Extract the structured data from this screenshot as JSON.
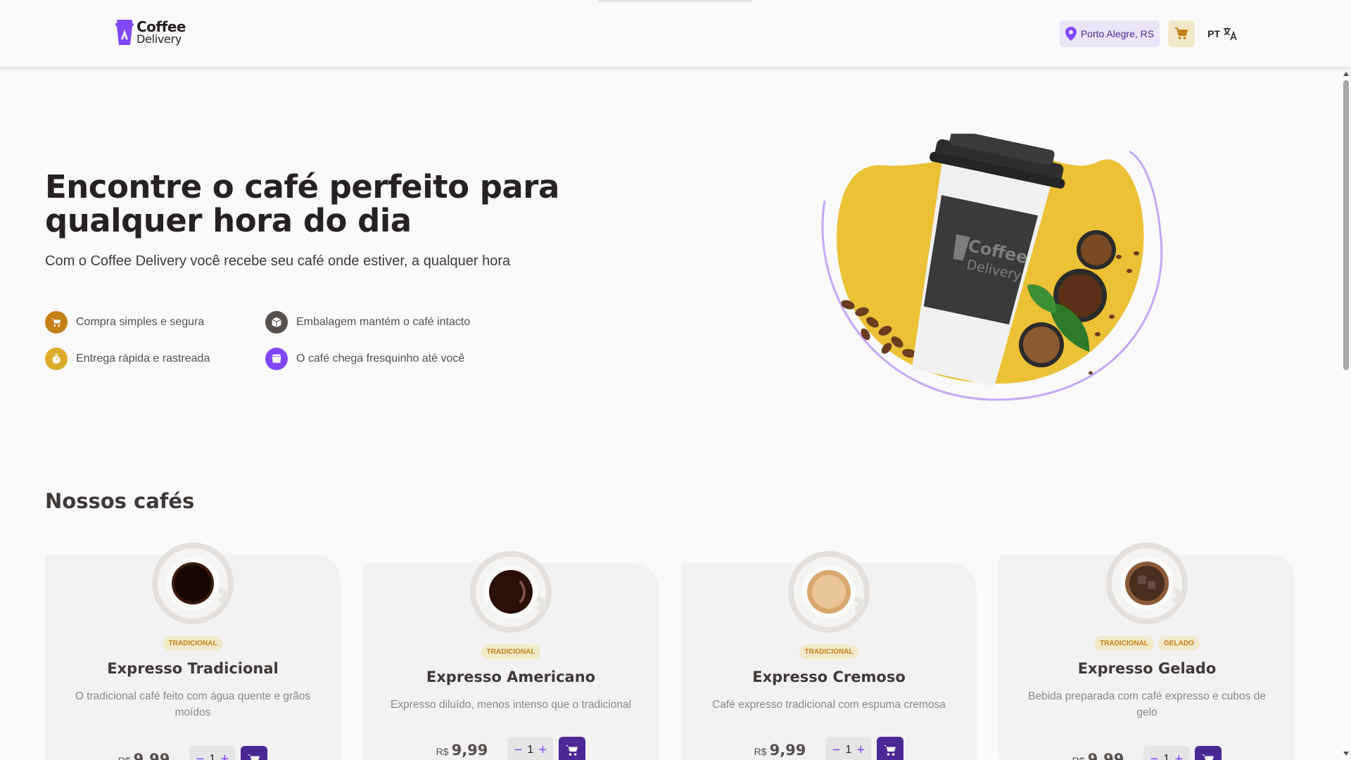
{
  "header": {
    "logo_line1": "Coffee",
    "logo_line2": "Delivery",
    "location": "Porto Alegre, RS",
    "language": "PT"
  },
  "hero": {
    "title": "Encontre o café perfeito para qualquer hora do dia",
    "subtitle": "Com o Coffee Delivery você recebe seu café onde estiver, a qualquer hora",
    "features": [
      {
        "label": "Compra simples e segura",
        "icon": "cart-icon",
        "color": "#c47f17"
      },
      {
        "label": "Embalagem mantém o café intacto",
        "icon": "package-icon",
        "color": "#574f4d"
      },
      {
        "label": "Entrega rápida e rastreada",
        "icon": "timer-icon",
        "color": "#dbac2c"
      },
      {
        "label": "O café chega fresquinho até você",
        "icon": "coffee-icon",
        "color": "#8047f8"
      }
    ],
    "cup_brand_line1": "Coffee",
    "cup_brand_line2": "Delivery"
  },
  "catalog": {
    "title": "Nossos cafés",
    "currency": "R$",
    "coffees": [
      {
        "name": "Expresso Tradicional",
        "tags": [
          "TRADICIONAL"
        ],
        "description": "O tradicional café feito com água quente e grãos moídos",
        "price": "9,99",
        "quantity": "1"
      },
      {
        "name": "Expresso Americano",
        "tags": [
          "TRADICIONAL"
        ],
        "description": "Expresso diluído, menos intenso que o tradicional",
        "price": "9,99",
        "quantity": "1"
      },
      {
        "name": "Expresso Cremoso",
        "tags": [
          "TRADICIONAL"
        ],
        "description": "Café expresso tradicional com espuma cremosa",
        "price": "9,99",
        "quantity": "1"
      },
      {
        "name": "Expresso Gelado",
        "tags": [
          "TRADICIONAL",
          "GELADO"
        ],
        "description": "Bebida preparada com café expresso e cubos de gelo",
        "price": "9,99",
        "quantity": "1"
      }
    ]
  },
  "colors": {
    "purple_dark": "#4b2995",
    "purple": "#8047f8",
    "purple_light": "#ebe5f9",
    "yellow_dark": "#c47f17",
    "yellow": "#dbac2c",
    "yellow_light": "#f1e9c9",
    "background": "#fafafa"
  }
}
